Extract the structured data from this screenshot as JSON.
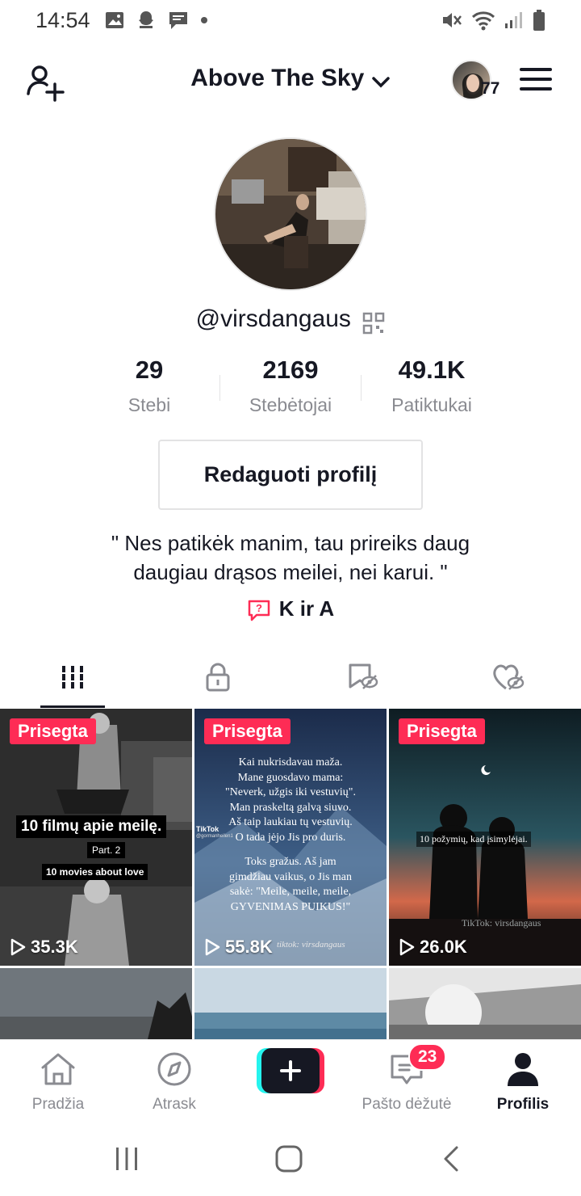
{
  "status_bar": {
    "time": "14:54",
    "left_icons": [
      "image-icon",
      "snapchat-icon",
      "message-icon",
      "dot-icon"
    ],
    "right_icons": [
      "mute-icon",
      "wifi-icon",
      "signal-icon",
      "battery-icon"
    ]
  },
  "header": {
    "title": "Above The Sky",
    "story_count": "77"
  },
  "profile": {
    "username": "@virsdangaus",
    "stats": [
      {
        "value": "29",
        "label": "Stebi"
      },
      {
        "value": "2169",
        "label": "Stebėtojai"
      },
      {
        "value": "49.1K",
        "label": "Patiktukai"
      }
    ],
    "edit_button": "Redaguoti profilį",
    "bio_line1": "\" Nes patikėk manim, tau prireiks daug",
    "bio_line2": "daugiau drąsos meilei, nei karui. \"",
    "link_text": "K ir A"
  },
  "tabs": [
    "videos-grid-icon",
    "lock-icon",
    "bookmark-hidden-icon",
    "heart-hidden-icon"
  ],
  "videos": [
    {
      "pinned": "Prisegta",
      "views": "35.3K",
      "title": "10 filmų apie meilę.",
      "part": "Part. 2",
      "subtitle": "10 movies about love"
    },
    {
      "pinned": "Prisegta",
      "views": "55.8K",
      "poem1": "Kai nukrisdavau maža.",
      "poem2": "Mane guosdavo mama:",
      "poem3": "\"Neverk, užgis iki vestuvių\".",
      "poem4": "Man praskeltą galvą siuvo.",
      "poem5": "Aš taip laukiau tų vestuvių.",
      "poem6": "O tada jėjo Jis pro duris.",
      "poem7": "Toks gražus. Aš jam",
      "poem8": "gimdžiau vaikus, o Jis man",
      "poem9": "sakė: \"Meile, meile, meile,",
      "poem10": "GYVENIMAS PUIKUS!\"",
      "brand": "TikTok",
      "handle": "@gormanheilen1",
      "watermark": "tiktok: virsdangaus"
    },
    {
      "pinned": "Prisegta",
      "views": "26.0K",
      "caption": "10 požymių, kad įsimylėjai.",
      "watermark": "TikTok: virsdangaus"
    }
  ],
  "bottom_nav": [
    {
      "label": "Pradžia",
      "icon": "home-icon"
    },
    {
      "label": "Atrask",
      "icon": "compass-icon"
    },
    {
      "label": "",
      "icon": "plus-icon"
    },
    {
      "label": "Pašto dėžutė",
      "icon": "inbox-icon",
      "badge": "23"
    },
    {
      "label": "Profilis",
      "icon": "profile-icon"
    }
  ],
  "colors": {
    "accent": "#fe2c55",
    "cyan": "#25f4ee",
    "text": "#161823",
    "muted": "#8a8b91"
  }
}
